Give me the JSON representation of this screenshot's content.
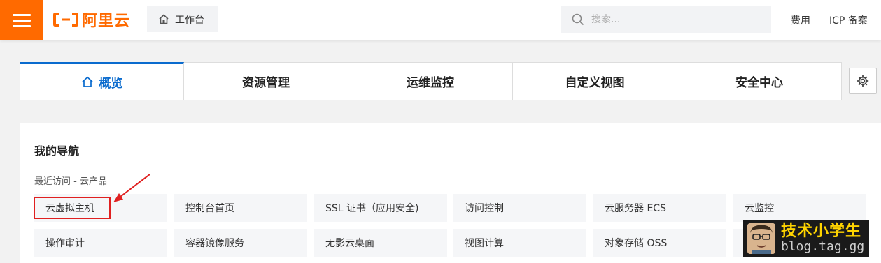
{
  "header": {
    "logo_text": "阿里云",
    "workbench_label": "工作台",
    "search_placeholder": "搜索...",
    "links": [
      "费用",
      "ICP 备案"
    ]
  },
  "tabs": [
    {
      "label": "概览",
      "active": true
    },
    {
      "label": "资源管理",
      "active": false
    },
    {
      "label": "运维监控",
      "active": false
    },
    {
      "label": "自定义视图",
      "active": false
    },
    {
      "label": "安全中心",
      "active": false
    }
  ],
  "nav": {
    "title": "我的导航",
    "recent_label": "最近访问 - 云产品",
    "row1": [
      "云虚拟主机",
      "控制台首页",
      "SSL 证书（应用安全)",
      "访问控制",
      "云服务器 ECS",
      "云监控"
    ],
    "row2": [
      "操作审计",
      "容器镜像服务",
      "无影云桌面",
      "视图计算",
      "对象存储 OSS",
      ""
    ]
  },
  "watermark": {
    "title": "技术小学生",
    "url": "blog.tag.gg"
  },
  "colors": {
    "brand_orange": "#ff6a00",
    "active_blue": "#0a6bce",
    "highlight_red": "#e02020"
  }
}
